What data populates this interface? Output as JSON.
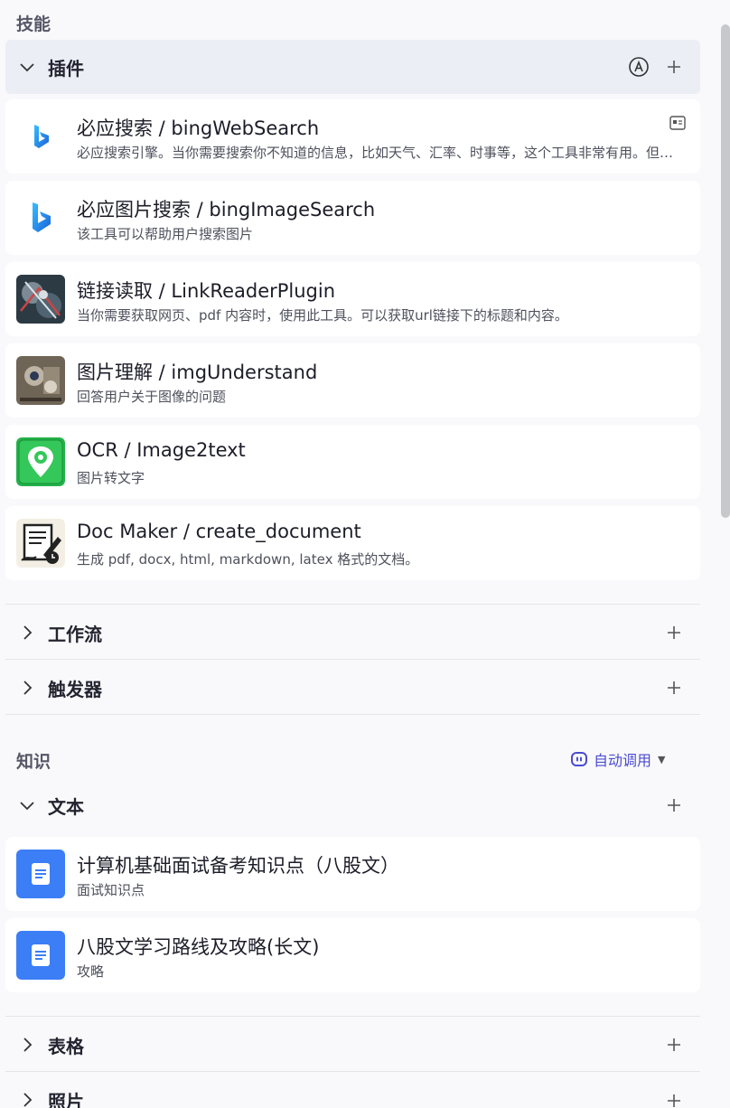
{
  "skills": {
    "title": "技能",
    "plugins": {
      "label": "插件",
      "items": [
        {
          "name": "必应搜索 / bingWebSearch",
          "desc": "必应搜索引擎。当你需要搜索你不知道的信息，比如天气、汇率、时事等，这个工具非常有用。但是绝对不要在用户想要翻译的时候使用它。",
          "icon": "bing-logo"
        },
        {
          "name": "必应图片搜索 / bingImageSearch",
          "desc": "该工具可以帮助用户搜索图片",
          "icon": "bing-logo"
        },
        {
          "name": "链接读取 / LinkReaderPlugin",
          "desc": "当你需要获取网页、pdf 内容时，使用此工具。可以获取url链接下的标题和内容。",
          "icon": "link-reader-image"
        },
        {
          "name": "图片理解 / imgUnderstand",
          "desc": "回答用户关于图像的问题",
          "icon": "img-understand-image"
        },
        {
          "name": "OCR / Image2text",
          "desc": "图片转文字",
          "icon": "ocr-icon"
        },
        {
          "name": "Doc Maker / create_document",
          "desc": "生成 pdf, docx, html, markdown, latex 格式的文档。",
          "icon": "doc-maker-icon"
        }
      ]
    },
    "workflow": {
      "label": "工作流"
    },
    "trigger": {
      "label": "触发器"
    }
  },
  "knowledge": {
    "title": "知识",
    "auto_call_label": "自动调用",
    "text": {
      "label": "文本",
      "items": [
        {
          "name": "计算机基础面试备考知识点（八股文）",
          "desc": "面试知识点"
        },
        {
          "name": "八股文学习路线及攻略(长文)",
          "desc": "攻略"
        }
      ]
    },
    "table": {
      "label": "表格"
    },
    "photo": {
      "label": "照片"
    }
  },
  "colors": {
    "accent": "#4b4ccf",
    "doc_blue": "#3b7ef6",
    "header_active": "#eceef6"
  }
}
